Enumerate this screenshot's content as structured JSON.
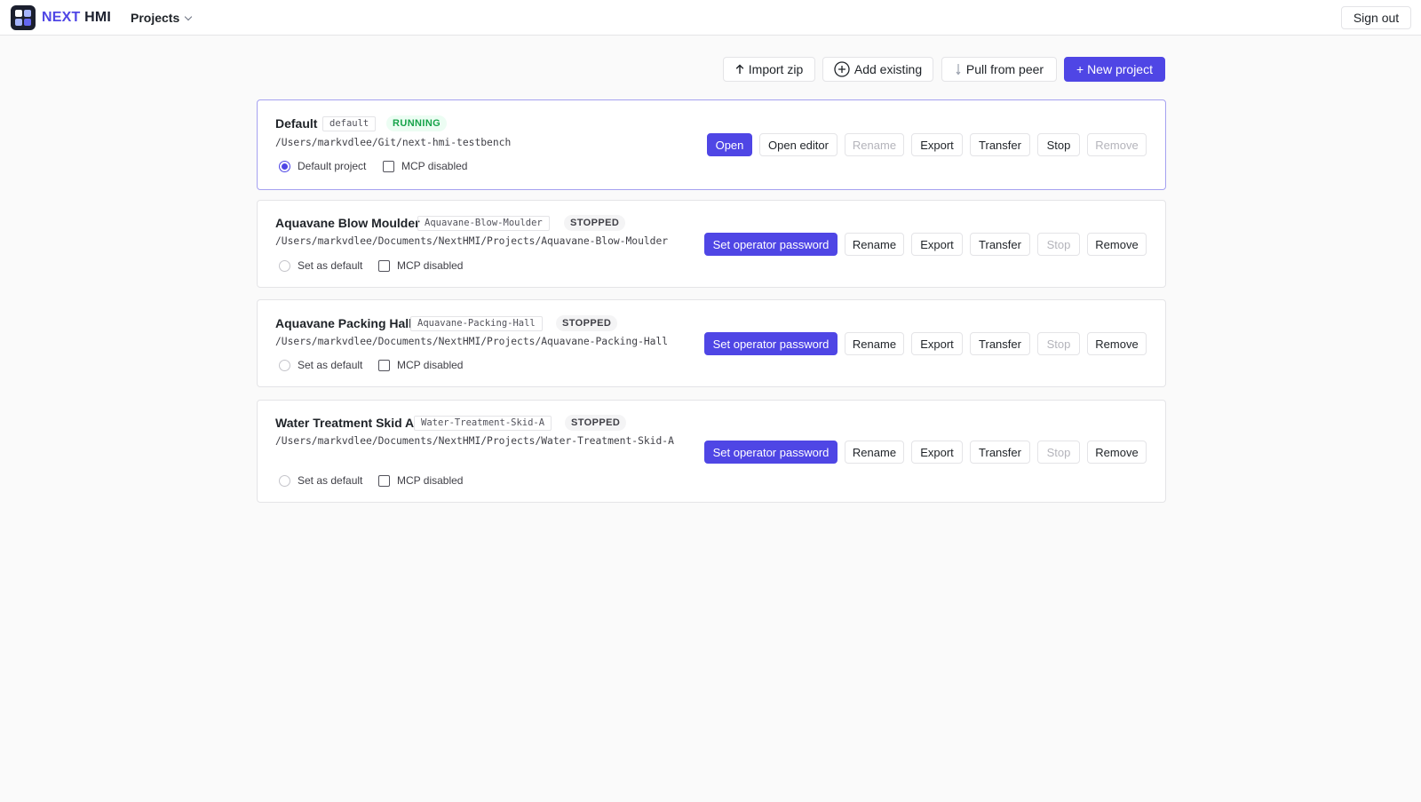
{
  "header": {
    "brand_part1": "NEXT",
    "brand_part2": "HMI",
    "nav_label": "Projects",
    "signout_label": "Sign out"
  },
  "toolbar": {
    "import_label": "Import zip",
    "add_existing_label": "Add existing",
    "pull_label": "Pull from peer",
    "new_project_label": "+ New project"
  },
  "projects": [
    {
      "name": "Default",
      "slug": "default",
      "status": "RUNNING",
      "path": "/Users/markvdlee/Git/next-hmi-testbench",
      "default_label": "Default project",
      "mcp_label": "MCP disabled",
      "actions": {
        "open": "Open",
        "open_editor": "Open editor",
        "rename": "Rename",
        "export": "Export",
        "transfer": "Transfer",
        "stop": "Stop",
        "remove": "Remove"
      }
    },
    {
      "name": "Aquavane Blow Moulder",
      "slug": "Aquavane-Blow-Moulder",
      "status": "STOPPED",
      "path": "/Users/markvdlee/Documents/NextHMI/Projects/Aquavane-Blow-Moulder",
      "default_label": "Set as default",
      "mcp_label": "MCP disabled",
      "actions": {
        "set_password": "Set operator password",
        "rename": "Rename",
        "export": "Export",
        "transfer": "Transfer",
        "stop": "Stop",
        "remove": "Remove"
      }
    },
    {
      "name": "Aquavane Packing Hall",
      "slug": "Aquavane-Packing-Hall",
      "status": "STOPPED",
      "path": "/Users/markvdlee/Documents/NextHMI/Projects/Aquavane-Packing-Hall",
      "default_label": "Set as default",
      "mcp_label": "MCP disabled",
      "actions": {
        "set_password": "Set operator password",
        "rename": "Rename",
        "export": "Export",
        "transfer": "Transfer",
        "stop": "Stop",
        "remove": "Remove"
      }
    },
    {
      "name": "Water Treatment Skid A",
      "slug": "Water-Treatment-Skid-A",
      "status": "STOPPED",
      "path": "/Users/markvdlee/Documents/NextHMI/Projects/Water-Treatment-Skid-A",
      "default_label": "Set as default",
      "mcp_label": "MCP disabled",
      "actions": {
        "set_password": "Set operator password",
        "rename": "Rename",
        "export": "Export",
        "transfer": "Transfer",
        "stop": "Stop",
        "remove": "Remove"
      }
    }
  ],
  "colors": {
    "accent": "#4f46e5",
    "running_text": "#16a34a",
    "running_bg": "#ecfdf3",
    "stopped_bg": "#f4f4f5"
  }
}
